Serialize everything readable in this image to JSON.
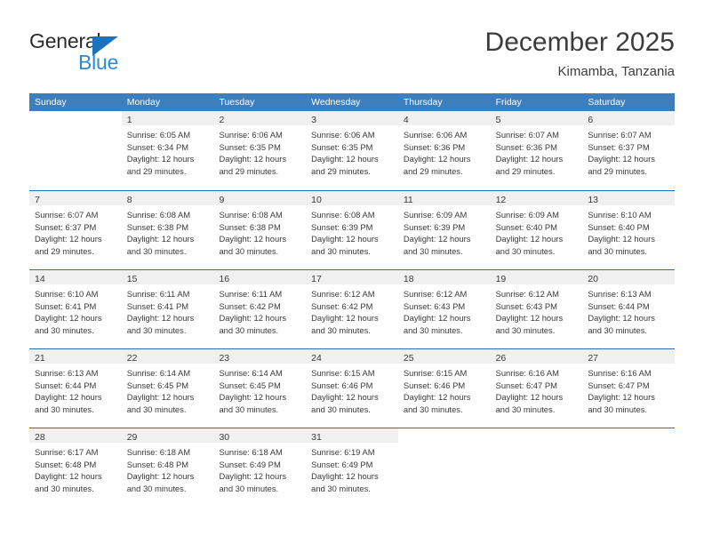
{
  "brand": {
    "name_part1": "General",
    "name_part2": "Blue",
    "triangle_icon": "triangle-icon",
    "accent_dark": "#1c72bb",
    "accent_light": "#2e8ad4"
  },
  "header": {
    "title": "December 2025",
    "subtitle": "Kimamba, Tanzania"
  },
  "theme": {
    "header_bar": "#3d7ebd",
    "row_divider": "#2a6db3",
    "day_band": "#f0f0f0",
    "text": "#3a3a3a"
  },
  "calendar": {
    "weekdays": [
      "Sunday",
      "Monday",
      "Tuesday",
      "Wednesday",
      "Thursday",
      "Friday",
      "Saturday"
    ],
    "weeks": [
      [
        {
          "day": "",
          "lines": []
        },
        {
          "day": "1",
          "lines": [
            "Sunrise: 6:05 AM",
            "Sunset: 6:34 PM",
            "Daylight: 12 hours",
            "and 29 minutes."
          ]
        },
        {
          "day": "2",
          "lines": [
            "Sunrise: 6:06 AM",
            "Sunset: 6:35 PM",
            "Daylight: 12 hours",
            "and 29 minutes."
          ]
        },
        {
          "day": "3",
          "lines": [
            "Sunrise: 6:06 AM",
            "Sunset: 6:35 PM",
            "Daylight: 12 hours",
            "and 29 minutes."
          ]
        },
        {
          "day": "4",
          "lines": [
            "Sunrise: 6:06 AM",
            "Sunset: 6:36 PM",
            "Daylight: 12 hours",
            "and 29 minutes."
          ]
        },
        {
          "day": "5",
          "lines": [
            "Sunrise: 6:07 AM",
            "Sunset: 6:36 PM",
            "Daylight: 12 hours",
            "and 29 minutes."
          ]
        },
        {
          "day": "6",
          "lines": [
            "Sunrise: 6:07 AM",
            "Sunset: 6:37 PM",
            "Daylight: 12 hours",
            "and 29 minutes."
          ]
        }
      ],
      [
        {
          "day": "7",
          "lines": [
            "Sunrise: 6:07 AM",
            "Sunset: 6:37 PM",
            "Daylight: 12 hours",
            "and 29 minutes."
          ]
        },
        {
          "day": "8",
          "lines": [
            "Sunrise: 6:08 AM",
            "Sunset: 6:38 PM",
            "Daylight: 12 hours",
            "and 30 minutes."
          ]
        },
        {
          "day": "9",
          "lines": [
            "Sunrise: 6:08 AM",
            "Sunset: 6:38 PM",
            "Daylight: 12 hours",
            "and 30 minutes."
          ]
        },
        {
          "day": "10",
          "lines": [
            "Sunrise: 6:08 AM",
            "Sunset: 6:39 PM",
            "Daylight: 12 hours",
            "and 30 minutes."
          ]
        },
        {
          "day": "11",
          "lines": [
            "Sunrise: 6:09 AM",
            "Sunset: 6:39 PM",
            "Daylight: 12 hours",
            "and 30 minutes."
          ]
        },
        {
          "day": "12",
          "lines": [
            "Sunrise: 6:09 AM",
            "Sunset: 6:40 PM",
            "Daylight: 12 hours",
            "and 30 minutes."
          ]
        },
        {
          "day": "13",
          "lines": [
            "Sunrise: 6:10 AM",
            "Sunset: 6:40 PM",
            "Daylight: 12 hours",
            "and 30 minutes."
          ]
        }
      ],
      [
        {
          "day": "14",
          "lines": [
            "Sunrise: 6:10 AM",
            "Sunset: 6:41 PM",
            "Daylight: 12 hours",
            "and 30 minutes."
          ]
        },
        {
          "day": "15",
          "lines": [
            "Sunrise: 6:11 AM",
            "Sunset: 6:41 PM",
            "Daylight: 12 hours",
            "and 30 minutes."
          ]
        },
        {
          "day": "16",
          "lines": [
            "Sunrise: 6:11 AM",
            "Sunset: 6:42 PM",
            "Daylight: 12 hours",
            "and 30 minutes."
          ]
        },
        {
          "day": "17",
          "lines": [
            "Sunrise: 6:12 AM",
            "Sunset: 6:42 PM",
            "Daylight: 12 hours",
            "and 30 minutes."
          ]
        },
        {
          "day": "18",
          "lines": [
            "Sunrise: 6:12 AM",
            "Sunset: 6:43 PM",
            "Daylight: 12 hours",
            "and 30 minutes."
          ]
        },
        {
          "day": "19",
          "lines": [
            "Sunrise: 6:12 AM",
            "Sunset: 6:43 PM",
            "Daylight: 12 hours",
            "and 30 minutes."
          ]
        },
        {
          "day": "20",
          "lines": [
            "Sunrise: 6:13 AM",
            "Sunset: 6:44 PM",
            "Daylight: 12 hours",
            "and 30 minutes."
          ]
        }
      ],
      [
        {
          "day": "21",
          "lines": [
            "Sunrise: 6:13 AM",
            "Sunset: 6:44 PM",
            "Daylight: 12 hours",
            "and 30 minutes."
          ]
        },
        {
          "day": "22",
          "lines": [
            "Sunrise: 6:14 AM",
            "Sunset: 6:45 PM",
            "Daylight: 12 hours",
            "and 30 minutes."
          ]
        },
        {
          "day": "23",
          "lines": [
            "Sunrise: 6:14 AM",
            "Sunset: 6:45 PM",
            "Daylight: 12 hours",
            "and 30 minutes."
          ]
        },
        {
          "day": "24",
          "lines": [
            "Sunrise: 6:15 AM",
            "Sunset: 6:46 PM",
            "Daylight: 12 hours",
            "and 30 minutes."
          ]
        },
        {
          "day": "25",
          "lines": [
            "Sunrise: 6:15 AM",
            "Sunset: 6:46 PM",
            "Daylight: 12 hours",
            "and 30 minutes."
          ]
        },
        {
          "day": "26",
          "lines": [
            "Sunrise: 6:16 AM",
            "Sunset: 6:47 PM",
            "Daylight: 12 hours",
            "and 30 minutes."
          ]
        },
        {
          "day": "27",
          "lines": [
            "Sunrise: 6:16 AM",
            "Sunset: 6:47 PM",
            "Daylight: 12 hours",
            "and 30 minutes."
          ]
        }
      ],
      [
        {
          "day": "28",
          "lines": [
            "Sunrise: 6:17 AM",
            "Sunset: 6:48 PM",
            "Daylight: 12 hours",
            "and 30 minutes."
          ]
        },
        {
          "day": "29",
          "lines": [
            "Sunrise: 6:18 AM",
            "Sunset: 6:48 PM",
            "Daylight: 12 hours",
            "and 30 minutes."
          ]
        },
        {
          "day": "30",
          "lines": [
            "Sunrise: 6:18 AM",
            "Sunset: 6:49 PM",
            "Daylight: 12 hours",
            "and 30 minutes."
          ]
        },
        {
          "day": "31",
          "lines": [
            "Sunrise: 6:19 AM",
            "Sunset: 6:49 PM",
            "Daylight: 12 hours",
            "and 30 minutes."
          ]
        },
        {
          "day": "",
          "lines": []
        },
        {
          "day": "",
          "lines": []
        },
        {
          "day": "",
          "lines": []
        }
      ]
    ]
  }
}
